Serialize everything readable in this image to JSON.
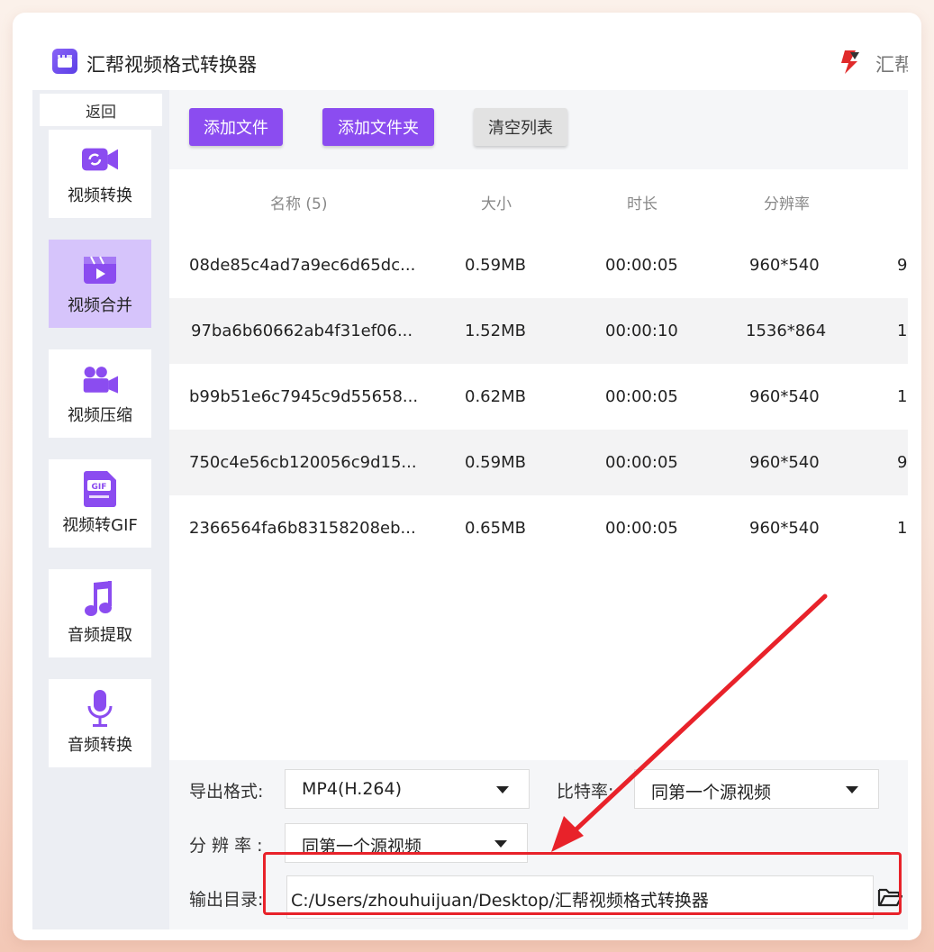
{
  "app": {
    "title": "汇帮视频格式转换器",
    "brand_text_partial": "汇帮",
    "accent_color": "#8b4cf0",
    "highlight_color": "#e8222a"
  },
  "sidebar": {
    "back_label": "返回",
    "items": [
      {
        "label": "视频转换",
        "icon": "video-convert-icon",
        "active": false
      },
      {
        "label": "视频合并",
        "icon": "video-merge-icon",
        "active": true
      },
      {
        "label": "视频压缩",
        "icon": "video-compress-icon",
        "active": false
      },
      {
        "label": "视频转GIF",
        "icon": "gif-icon",
        "active": false
      },
      {
        "label": "音频提取",
        "icon": "music-note-icon",
        "active": false
      },
      {
        "label": "音频转换",
        "icon": "microphone-icon",
        "active": false
      }
    ]
  },
  "toolbar": {
    "add_file": "添加文件",
    "add_folder": "添加文件夹",
    "clear_list": "清空列表"
  },
  "file_list": {
    "columns": [
      "名称 (5)",
      "大小",
      "时长",
      "分辨率"
    ],
    "rows": [
      {
        "name": "08de85c4ad7a9ec6d65dc...",
        "size": "0.59MB",
        "duration": "00:00:05",
        "resolution": "960*540",
        "extra": "9"
      },
      {
        "name": "97ba6b60662ab4f31ef06...",
        "size": "1.52MB",
        "duration": "00:00:10",
        "resolution": "1536*864",
        "extra": "1"
      },
      {
        "name": "b99b51e6c7945c9d55658...",
        "size": "0.62MB",
        "duration": "00:00:05",
        "resolution": "960*540",
        "extra": "1"
      },
      {
        "name": "750c4e56cb120056c9d15...",
        "size": "0.59MB",
        "duration": "00:00:05",
        "resolution": "960*540",
        "extra": "9"
      },
      {
        "name": "2366564fa6b83158208eb...",
        "size": "0.65MB",
        "duration": "00:00:05",
        "resolution": "960*540",
        "extra": "1"
      }
    ]
  },
  "settings": {
    "format_label": "导出格式:",
    "format_value": "MP4(H.264)",
    "bitrate_label": "比特率:",
    "bitrate_value": "同第一个源视频",
    "resolution_label": "分 辨 率 :",
    "resolution_value": "同第一个源视频",
    "output_label": "输出目录:",
    "output_path": "C:/Users/zhouhuijuan/Desktop/汇帮视频格式转换器"
  }
}
